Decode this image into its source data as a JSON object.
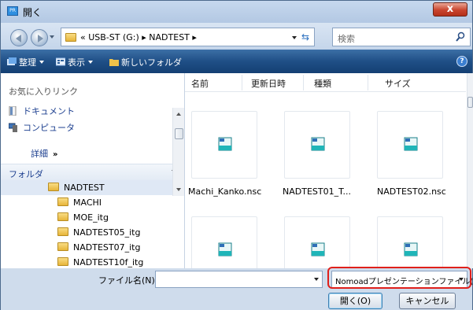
{
  "window": {
    "title": "開く",
    "close_label": "x"
  },
  "address": {
    "breadcrumb": "«  USB-ST (G:)  ▸  NADTEST  ▸",
    "search_placeholder": "検索"
  },
  "toolbar": {
    "organize_label": "整理",
    "view_label": "表示",
    "new_folder_label": "新しいフォルダ",
    "help_label": "?"
  },
  "left": {
    "favorites_header": "お気に入りリンク",
    "favorites": [
      {
        "label": "ドキュメント",
        "icon": "document-icon"
      },
      {
        "label": "コンピュータ",
        "icon": "computer-icon"
      }
    ],
    "details_label": "詳細",
    "details_chevron": "»",
    "folders_header": "フォルダ",
    "tree": [
      {
        "label": "NADTEST",
        "selected": true
      },
      {
        "label": "MACHI"
      },
      {
        "label": "MOE_itg"
      },
      {
        "label": "NADTEST05_itg"
      },
      {
        "label": "NADTEST07_itg"
      },
      {
        "label": "NADTEST10f_itg"
      }
    ]
  },
  "files": {
    "columns": [
      "名前",
      "更新日時",
      "種類",
      "サイズ"
    ],
    "items": [
      {
        "name": "Machi_Kanko.nsc"
      },
      {
        "name": "NADTEST01_T..."
      },
      {
        "name": "NADTEST02.nsc"
      },
      {
        "name": ""
      },
      {
        "name": ""
      },
      {
        "name": ""
      }
    ]
  },
  "bottom": {
    "filename_label": "ファイル名(N):",
    "filename_value": "",
    "filetype_value": "Nomoadプレゼンテーションファイル(",
    "open_label": "開く(O)",
    "cancel_label": "キャンセル"
  },
  "colors": {
    "toolbar": "#1f4f86",
    "highlight": "#e0201b",
    "link": "#1c3f8f"
  }
}
